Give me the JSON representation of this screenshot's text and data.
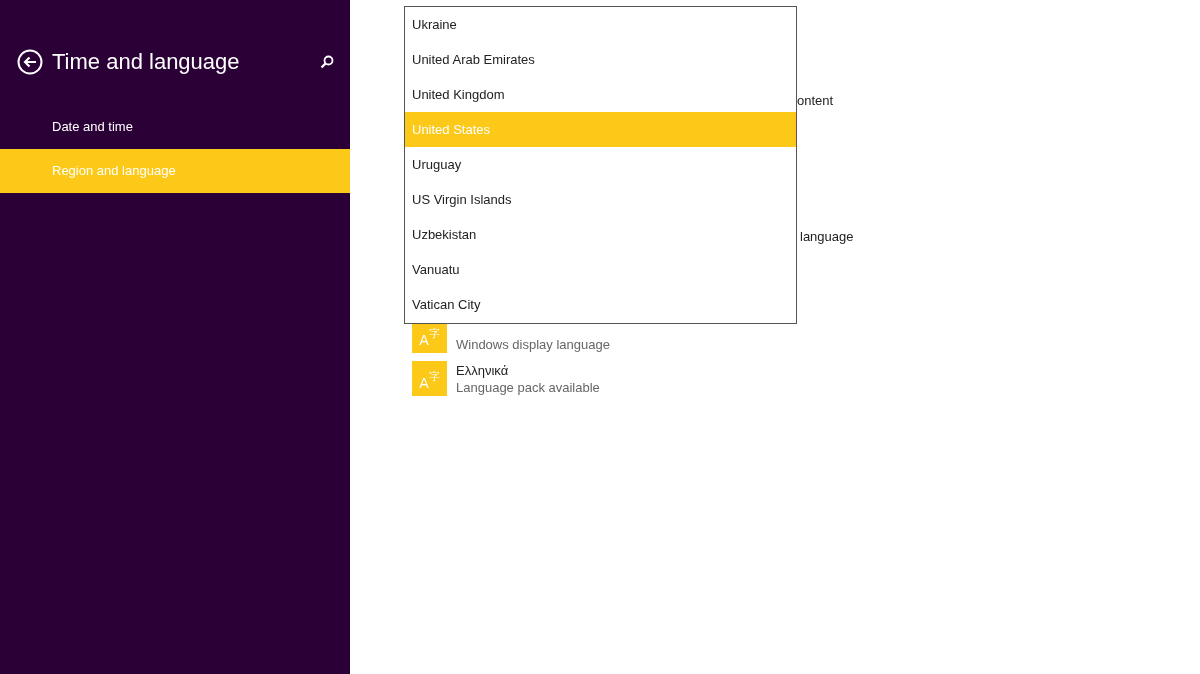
{
  "sidebar": {
    "title": "Time and language",
    "items": [
      {
        "label": "Date and time",
        "selected": false
      },
      {
        "label": "Region and language",
        "selected": true
      }
    ]
  },
  "content": {
    "fragments": [
      "ontent",
      "language"
    ],
    "languages": [
      {
        "icon_glyphs": [
          "A",
          "字"
        ],
        "detail": "Windows display language"
      },
      {
        "icon_glyphs": [
          "A",
          "字"
        ],
        "name": "Ελληνικά",
        "detail": "Language pack available"
      }
    ]
  },
  "country_dropdown": {
    "options": [
      {
        "label": "Ukraine",
        "selected": false
      },
      {
        "label": "United Arab Emirates",
        "selected": false
      },
      {
        "label": "United Kingdom",
        "selected": false
      },
      {
        "label": "United States",
        "selected": true
      },
      {
        "label": "Uruguay",
        "selected": false
      },
      {
        "label": "US Virgin Islands",
        "selected": false
      },
      {
        "label": "Uzbekistan",
        "selected": false
      },
      {
        "label": "Vanuatu",
        "selected": false
      },
      {
        "label": "Vatican City",
        "selected": false
      }
    ]
  }
}
